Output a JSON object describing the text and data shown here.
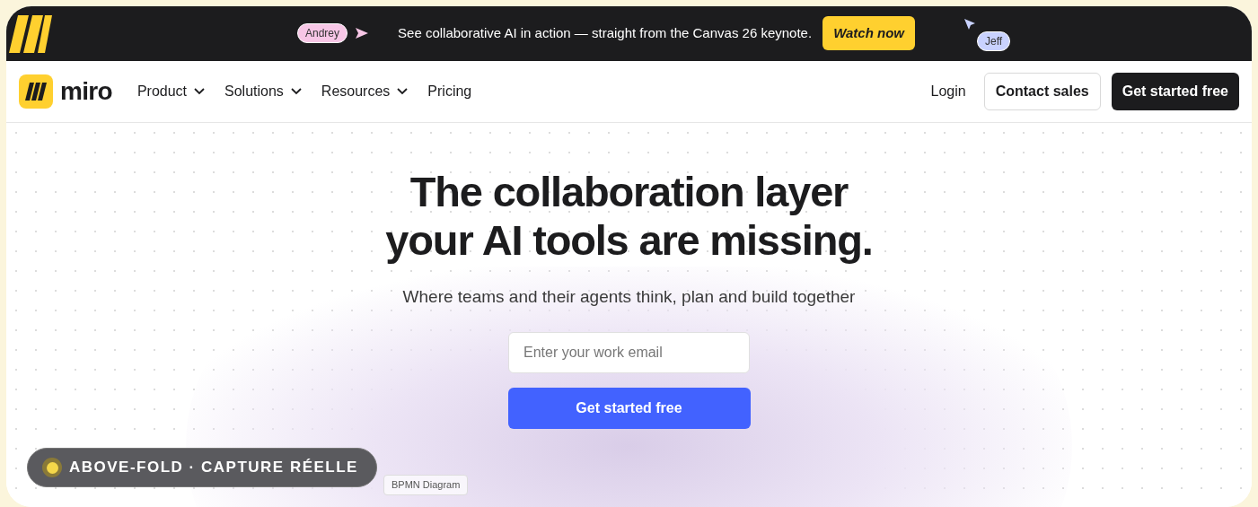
{
  "banner": {
    "cursor_left": {
      "label": "Andrey",
      "color": "#f7c6e6"
    },
    "message": "See collaborative AI in action — straight from the Canvas 26 keynote.",
    "button": "Watch now",
    "cursor_right": {
      "label": "Jeff",
      "color": "#c9d2ff"
    }
  },
  "nav": {
    "logo": "miro",
    "items": [
      {
        "label": "Product",
        "dropdown": true
      },
      {
        "label": "Solutions",
        "dropdown": true
      },
      {
        "label": "Resources",
        "dropdown": true
      },
      {
        "label": "Pricing",
        "dropdown": false
      }
    ],
    "login": "Login",
    "contact": "Contact sales",
    "cta": "Get started free"
  },
  "hero": {
    "title_lines": [
      "The collaboration layer",
      "your AI tools are missing."
    ],
    "subtitle": "Where teams and their agents think, plan and build together",
    "email": {
      "placeholder": "Enter your work email"
    },
    "button": "Get started free",
    "chip": "BPMN Diagram"
  },
  "overlay_badge": "ABOVE-FOLD · CAPTURE RÉELLE"
}
